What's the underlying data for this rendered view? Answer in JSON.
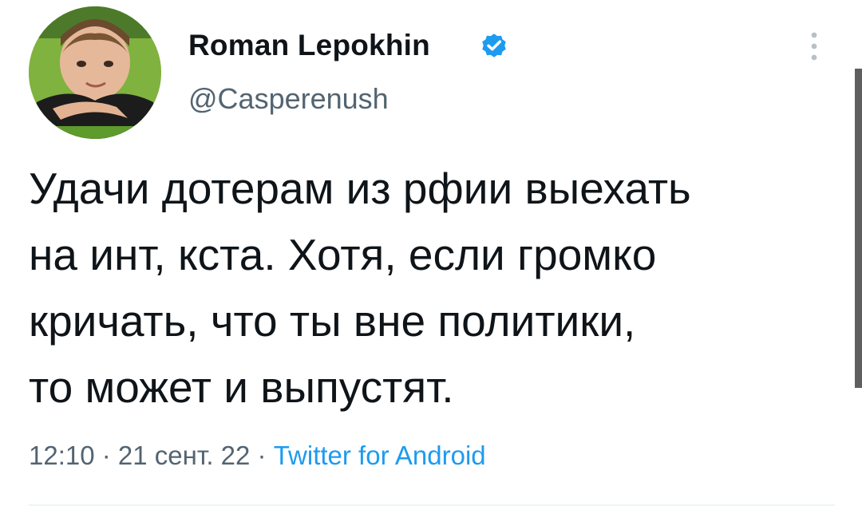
{
  "author": {
    "display_name": "Roman Lepokhin",
    "handle": "@Casperenush",
    "verified": true,
    "avatar_icon": "profile-photo"
  },
  "tweet": {
    "text": "Удачи дотерам из рфии выехать\nна инт, кста. Хотя, если громко\nкричать, что ты вне политики,\nто может и выпустят."
  },
  "meta": {
    "time": "12:10",
    "separator": " · ",
    "date": "21 сент. 22",
    "source": "Twitter for Android"
  },
  "icons": {
    "more": "more-vertical-icon",
    "verified": "verified-badge-icon"
  },
  "colors": {
    "accent": "#1d9bf0",
    "text": "#0f1419",
    "secondary": "#536471"
  }
}
